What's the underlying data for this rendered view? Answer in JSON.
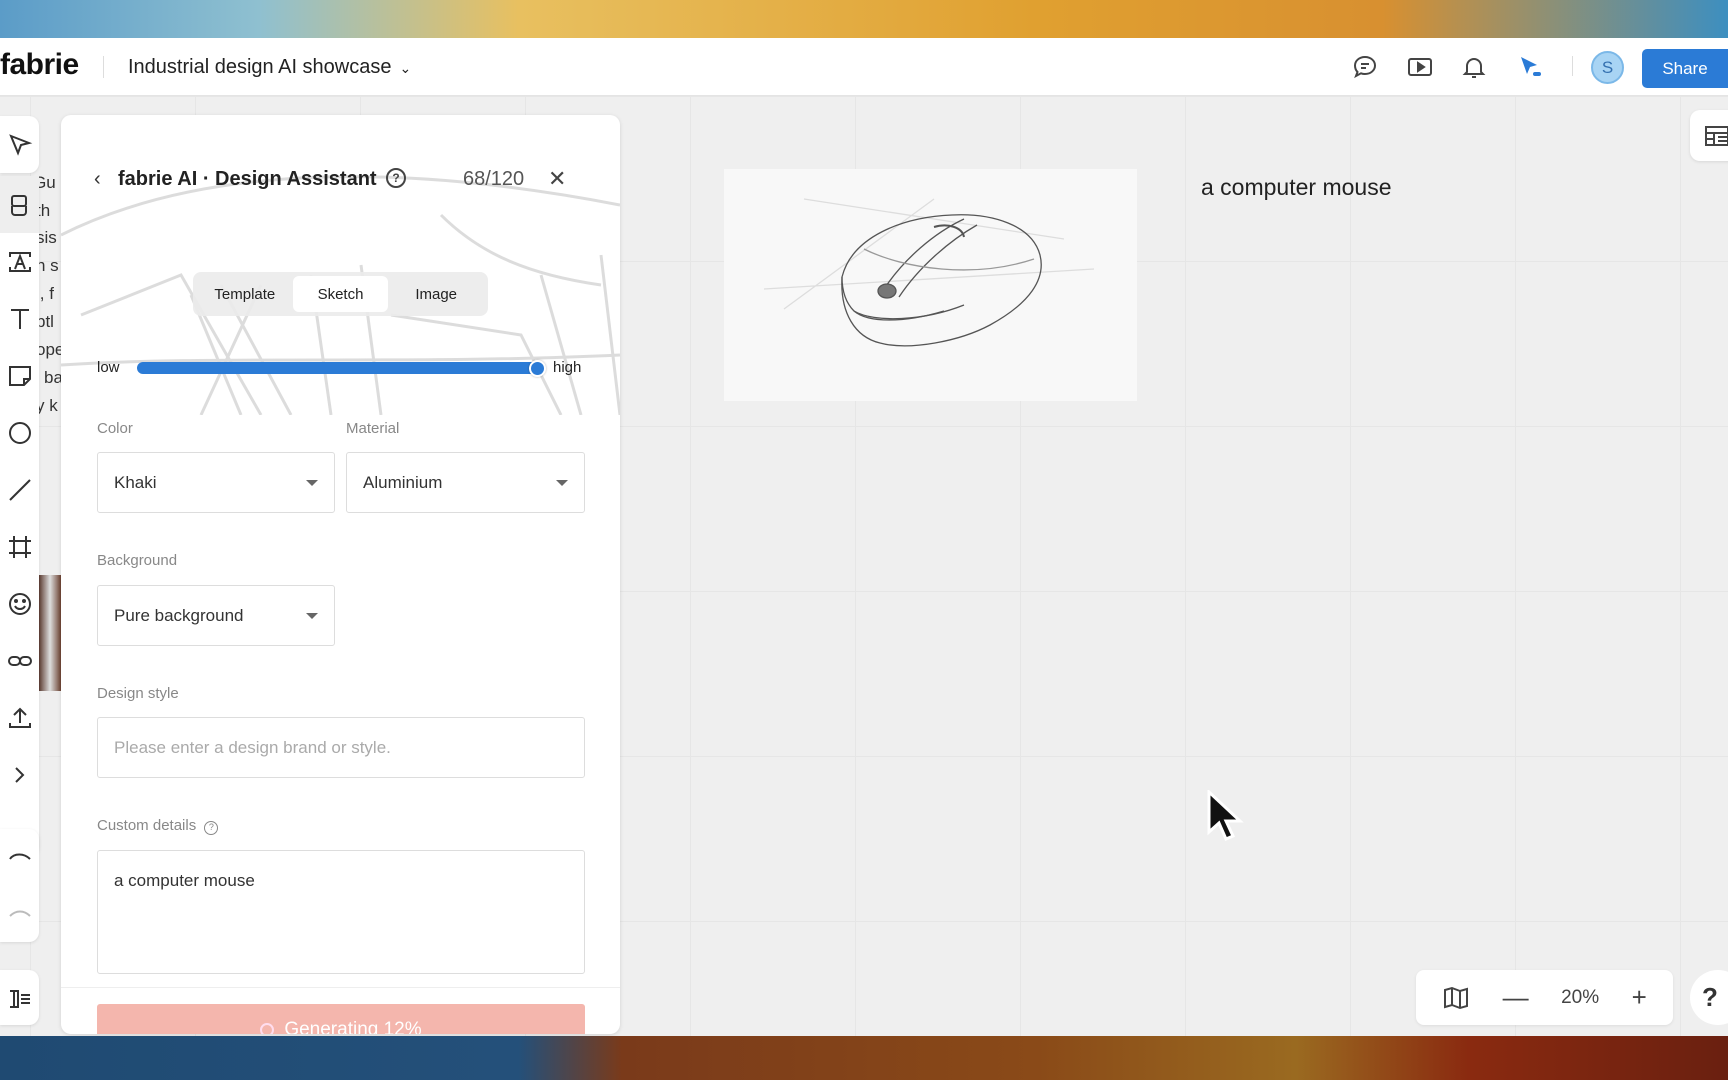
{
  "app": {
    "logo": "fabrie",
    "title": "Industrial design AI showcase"
  },
  "header": {
    "share_label": "Share",
    "avatar_initial": "S",
    "icons": [
      "comment-icon",
      "present-icon",
      "bell-icon",
      "cursor-follow-icon"
    ]
  },
  "background_fragments": [
    "and Gu",
    "th",
    "sis",
    "n s",
    "l, f",
    "btl",
    "ope",
    "ba",
    "y k"
  ],
  "panel": {
    "title": "fabrie AI · Design Assistant",
    "count": "68/120",
    "tabs": [
      {
        "label": "Template"
      },
      {
        "label": "Sketch",
        "active": true
      },
      {
        "label": "Image"
      }
    ],
    "slider": {
      "low_label": "low",
      "high_label": "high",
      "value_percent": 100
    },
    "color": {
      "label": "Color",
      "value": "Khaki"
    },
    "material": {
      "label": "Material",
      "value": "Aluminium"
    },
    "background": {
      "label": "Background",
      "value": "Pure background"
    },
    "design_style": {
      "label": "Design style",
      "placeholder": "Please enter a design brand or style.",
      "value": ""
    },
    "custom_details": {
      "label": "Custom details",
      "value": "a computer mouse"
    },
    "generate": {
      "label": "Generating 12%",
      "progress_percent": 12,
      "color": "#f4b6ad"
    }
  },
  "canvas": {
    "note_text": "a computer mouse",
    "image": "computer-mouse-sketch"
  },
  "zoom": {
    "value": "20%"
  },
  "help_label": "?",
  "colors": {
    "accent": "#2b7bd6",
    "canvas": "#efefef"
  }
}
